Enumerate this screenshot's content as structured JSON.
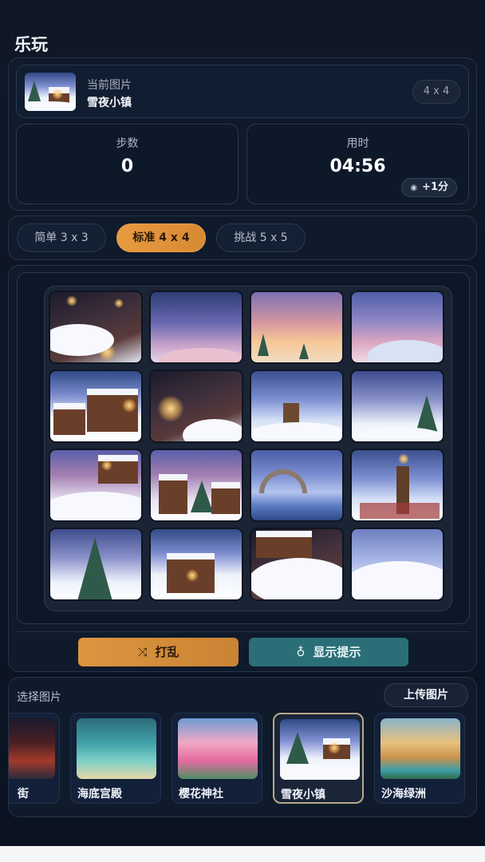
{
  "app": {
    "title": "乐玩"
  },
  "current_image": {
    "label": "当前图片",
    "name": "雪夜小镇",
    "grid_size": "4 x 4"
  },
  "stats": {
    "steps_label": "步数",
    "steps_value": "0",
    "time_label": "用时",
    "time_value": "04:56",
    "bonus_icon": "eye-icon",
    "bonus_label": "+1分"
  },
  "difficulty": {
    "options": [
      {
        "label": "简单 3 x 3",
        "active": false
      },
      {
        "label": "标准 4 x 4",
        "active": true
      },
      {
        "label": "挑战 5 x 5",
        "active": false
      }
    ]
  },
  "actions": {
    "shuffle_icon": "shuffle-icon",
    "shuffle_label": "打乱",
    "hint_icon": "lightbulb-icon",
    "hint_label": "显示提示"
  },
  "gallery": {
    "title": "选择图片",
    "upload_label": "上传图片",
    "items": [
      {
        "name": "古街",
        "visible_name": "街",
        "selected": false
      },
      {
        "name": "海底宫殿",
        "selected": false
      },
      {
        "name": "樱花神社",
        "selected": false
      },
      {
        "name": "雪夜小镇",
        "selected": true
      },
      {
        "name": "沙海绿洲",
        "selected": false
      }
    ]
  },
  "colors": {
    "accent_orange": "#e79a3f",
    "accent_teal": "#2a6f77",
    "background": "#0f1a2b"
  }
}
